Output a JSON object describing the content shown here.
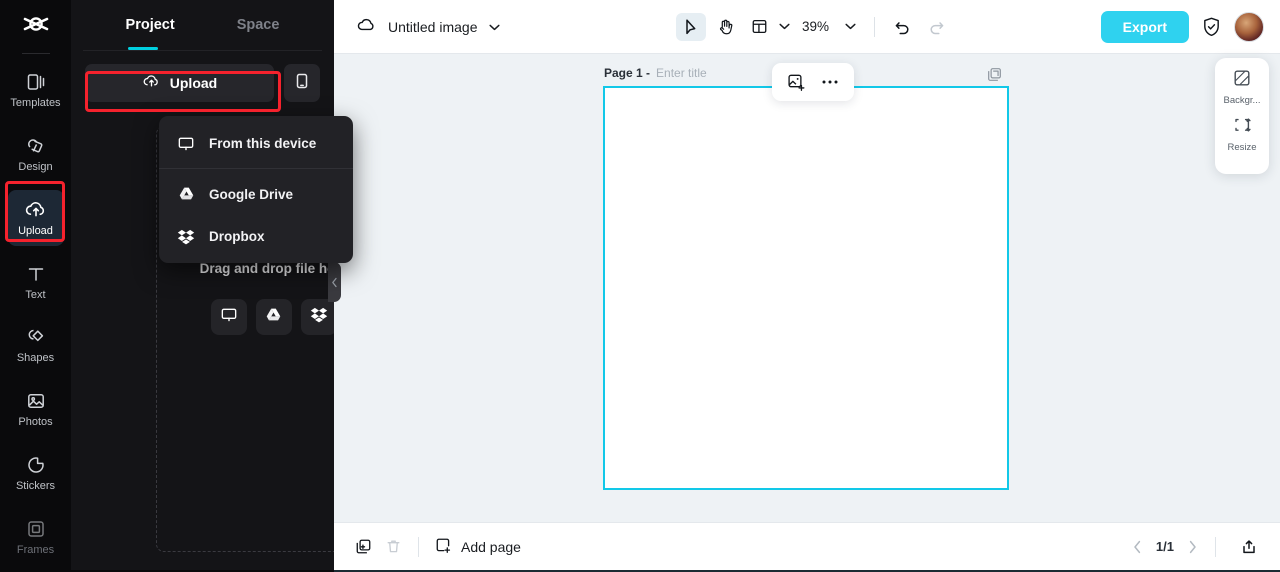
{
  "rail": {
    "logo_icon": "capcut-logo",
    "items": [
      {
        "label": "Templates",
        "icon": "templates-icon",
        "active": false,
        "dim": false
      },
      {
        "label": "Design",
        "icon": "design-icon",
        "active": false,
        "dim": false
      },
      {
        "label": "Upload",
        "icon": "upload-cloud-icon",
        "active": true,
        "dim": false
      },
      {
        "label": "Text",
        "icon": "text-icon",
        "active": false,
        "dim": false
      },
      {
        "label": "Shapes",
        "icon": "shapes-icon",
        "active": false,
        "dim": false
      },
      {
        "label": "Photos",
        "icon": "photos-icon",
        "active": false,
        "dim": false
      },
      {
        "label": "Stickers",
        "icon": "stickers-icon",
        "active": false,
        "dim": false
      },
      {
        "label": "Frames",
        "icon": "frames-icon",
        "active": false,
        "dim": true
      }
    ]
  },
  "panel": {
    "tab_project": "Project",
    "tab_space": "Space",
    "upload_button": "Upload",
    "phone_button_icon": "mobile-phone-icon",
    "dropzone_text": "Drag and drop file here",
    "dropzone_chips": [
      {
        "icon": "monitor-icon",
        "name": "from-this-device"
      },
      {
        "icon": "google-drive-icon",
        "name": "google-drive"
      },
      {
        "icon": "dropbox-icon",
        "name": "dropbox"
      }
    ]
  },
  "upload_menu": {
    "items": [
      {
        "label": "From this device",
        "icon": "monitor-icon"
      },
      {
        "label": "Google Drive",
        "icon": "google-drive-icon"
      },
      {
        "label": "Dropbox",
        "icon": "dropbox-icon"
      }
    ]
  },
  "topbar": {
    "cloud_icon": "cloud-icon",
    "doc_title": "Untitled image",
    "doc_caret_icon": "chevron-down-icon",
    "tools": [
      {
        "name": "select-tool",
        "icon": "cursor-arrow-icon",
        "active": true
      },
      {
        "name": "hand-tool",
        "icon": "hand-icon",
        "active": false
      },
      {
        "name": "layout-tool",
        "icon": "layout-icon",
        "active": false
      }
    ],
    "zoom_level": "39%",
    "undo_icon": "undo-icon",
    "redo_icon": "redo-icon",
    "export_label": "Export",
    "shield_icon": "shield-check-icon",
    "avatar_name": "user-avatar"
  },
  "canvas": {
    "page_label": "Page 1 -",
    "page_title_value": "",
    "page_title_placeholder": "Enter title",
    "float_tools": [
      {
        "name": "add-image",
        "icon": "image-plus-icon"
      },
      {
        "name": "more-options",
        "icon": "more-horizontal-icon"
      }
    ],
    "duplicate_icon": "duplicate-page-icon",
    "border_color": "#12c8e8"
  },
  "right_panel": {
    "items": [
      {
        "label": "Backgr...",
        "icon": "background-icon",
        "name": "background-button"
      },
      {
        "label": "Resize",
        "icon": "resize-icon",
        "name": "resize-button"
      }
    ]
  },
  "bottombar": {
    "duplicate_icon": "duplicate-icon",
    "delete_icon": "trash-icon",
    "add_page_label": "Add page",
    "add_page_icon": "add-page-icon",
    "page_counter": "1/1",
    "prev_icon": "chevron-left-icon",
    "next_icon": "chevron-right-icon",
    "export_share_icon": "export-tray-icon"
  },
  "colors": {
    "accent_cyan": "#00d0e0",
    "export_button": "#2fd2ef",
    "annotation_red": "#f5222d",
    "panel_bg": "#141417",
    "rail_bg": "#0a0a0c"
  }
}
